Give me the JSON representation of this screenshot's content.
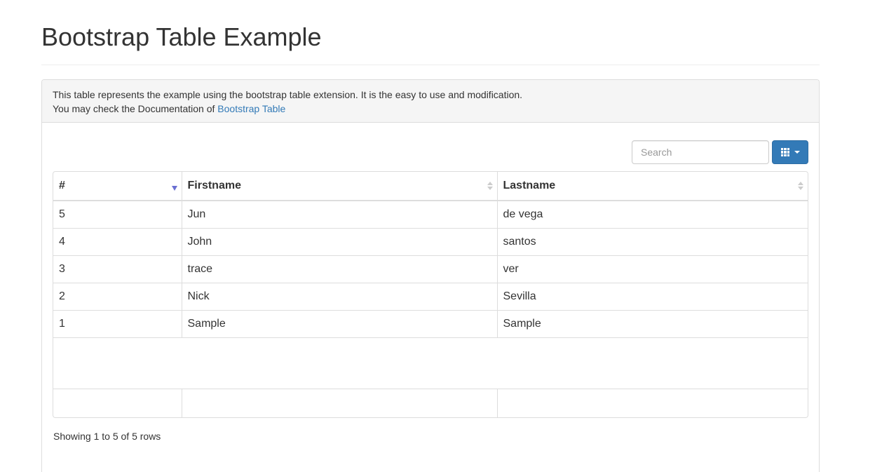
{
  "page": {
    "title": "Bootstrap Table Example"
  },
  "panel": {
    "description": "This table represents the example using the bootstrap table extension. It is the easy to use and modification.",
    "doc_prefix": "You may check the Documentation of ",
    "doc_link": "Bootstrap Table"
  },
  "toolbar": {
    "search_placeholder": "Search",
    "columns_icon": "grid-icon",
    "dropdown_icon": "caret-down-icon"
  },
  "table": {
    "columns": [
      "#",
      "Firstname",
      "Lastname"
    ],
    "sort": {
      "column": "#",
      "direction": "desc"
    },
    "rows": [
      {
        "num": "5",
        "firstname": "Jun",
        "lastname": "de vega"
      },
      {
        "num": "4",
        "firstname": "John",
        "lastname": "santos"
      },
      {
        "num": "3",
        "firstname": "trace",
        "lastname": "ver"
      },
      {
        "num": "2",
        "firstname": "Nick",
        "lastname": "Sevilla"
      },
      {
        "num": "1",
        "firstname": "Sample",
        "lastname": "Sample"
      }
    ]
  },
  "pagination": {
    "info": "Showing 1 to 5 of 5 rows"
  },
  "colors": {
    "primary": "#337ab7",
    "sort_active": "#6a6fd2",
    "border": "#dddddd",
    "heading_bg": "#f5f5f5"
  }
}
